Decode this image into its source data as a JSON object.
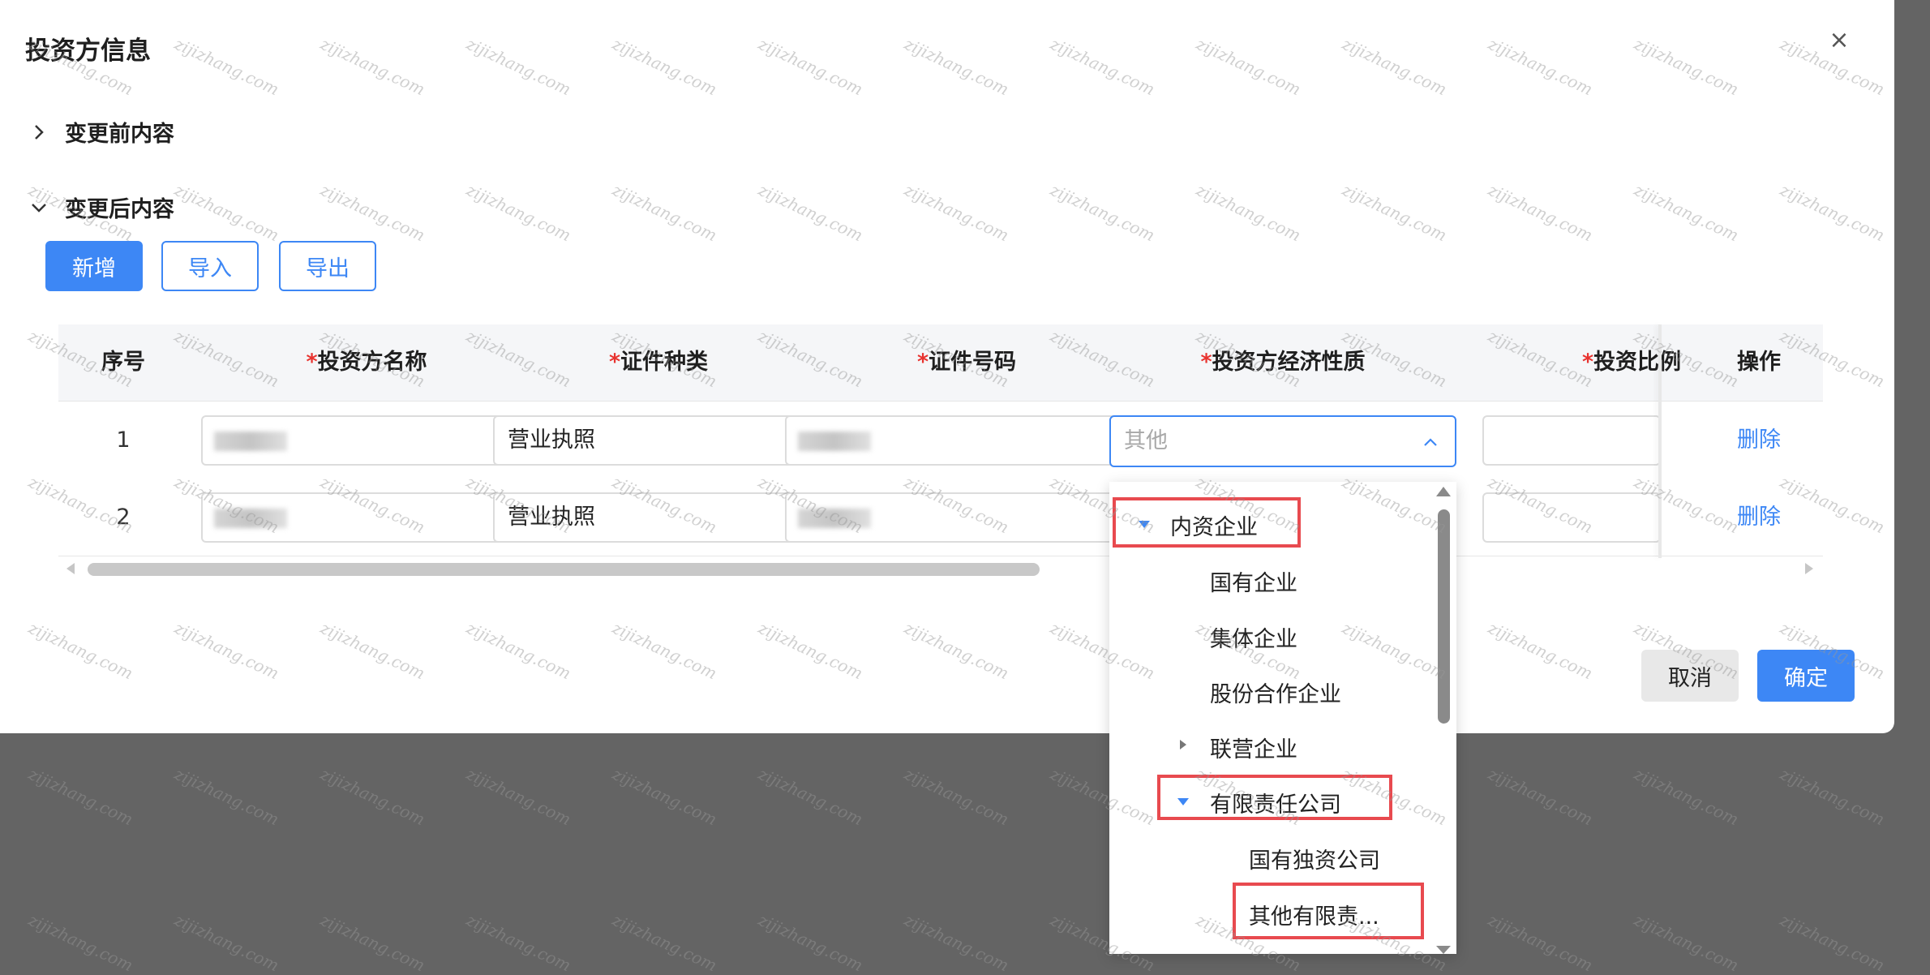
{
  "dialog": {
    "title": "投资方信息",
    "close_glyph": "×"
  },
  "sections": [
    {
      "label": "变更前内容",
      "expanded": false
    },
    {
      "label": "变更后内容",
      "expanded": true
    }
  ],
  "toolbar": {
    "add_label": "新增",
    "import_label": "导入",
    "export_label": "导出"
  },
  "table": {
    "required_mark": "*",
    "headers": {
      "index": "序号",
      "name": "投资方名称",
      "cert_type": "证件种类",
      "cert_no": "证件号码",
      "econ_nature": "投资方经济性质",
      "ratio": "投资比例",
      "actions": "操作"
    },
    "rows": [
      {
        "index": "1",
        "cert_type": "营业执照",
        "econ_nature_placeholder": "其他",
        "action": "删除"
      },
      {
        "index": "2",
        "cert_type": "营业执照",
        "action": "删除"
      }
    ]
  },
  "dropdown": {
    "items": [
      {
        "label": "内资企业",
        "expander": "expanded",
        "highlighted": true
      },
      {
        "label": "国有企业"
      },
      {
        "label": "集体企业"
      },
      {
        "label": "股份合作企业"
      },
      {
        "label": "联营企业",
        "expander": "collapsed"
      },
      {
        "label": "有限责任公司",
        "expander": "expanded",
        "highlighted": true
      },
      {
        "label": "国有独资公司"
      },
      {
        "label": "其他有限责...",
        "highlighted": true
      }
    ]
  },
  "footer": {
    "cancel_label": "取消",
    "confirm_label": "确定"
  },
  "watermark": {
    "text": "zijizhang.com"
  },
  "colors": {
    "primary": "#3d87f5",
    "required": "#e8332f",
    "highlight_box": "#e84a4f",
    "backdrop": "#646464"
  }
}
